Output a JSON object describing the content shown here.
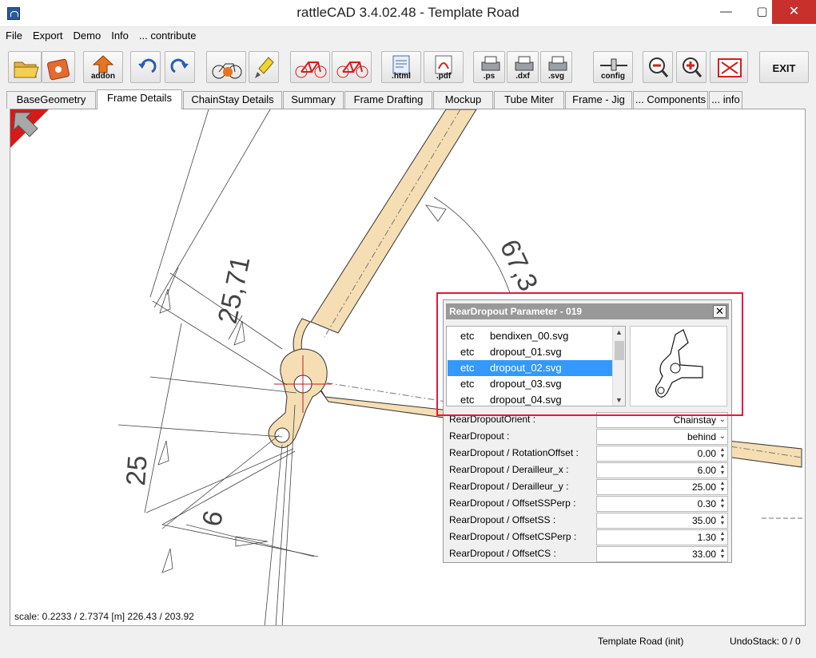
{
  "window": {
    "title": "rattleCAD  3.4.02.48 - Template Road",
    "minimize": "—",
    "maximize": "▢",
    "close": "✕"
  },
  "menu": [
    "File",
    "Export",
    "Demo",
    "Info",
    "... contribute"
  ],
  "toolbar": {
    "addon_label": "addon",
    "html_label": ".html",
    "pdf_label": ".pdf",
    "ps_label": ".ps",
    "dxf_label": ".dxf",
    "svg_label": ".svg",
    "config_label": "config",
    "exit_label": "EXIT"
  },
  "tabs": [
    "BaseGeometry",
    "Frame Details",
    "ChainStay Details",
    "Summary",
    "Frame Drafting",
    "Mockup",
    "Tube Miter",
    "Frame - Jig",
    "... Components",
    "... info"
  ],
  "active_tab": "Frame Details",
  "canvas": {
    "scale_text": "scale: 0.2233 / 2.7374  [m]  226.43 / 203.92",
    "dimensions": [
      "25,71",
      "25",
      "6",
      "67,3"
    ]
  },
  "panel": {
    "title": "RearDropout Parameter - 019",
    "close_icon": "✕",
    "files": [
      {
        "group": "etc",
        "name": "bendixen_00.svg"
      },
      {
        "group": "etc",
        "name": "dropout_01.svg"
      },
      {
        "group": "etc",
        "name": "dropout_02.svg"
      },
      {
        "group": "etc",
        "name": "dropout_03.svg"
      },
      {
        "group": "etc",
        "name": "dropout_04.svg"
      }
    ],
    "selected_file": "dropout_02.svg",
    "params": [
      {
        "label": "RearDropoutOrient  :",
        "value": "Chainstay",
        "kind": "select"
      },
      {
        "label": "RearDropout  :",
        "value": "behind",
        "kind": "select"
      },
      {
        "label": "RearDropout / RotationOffset  :",
        "value": "0.00",
        "kind": "spin"
      },
      {
        "label": "RearDropout / Derailleur_x  :",
        "value": "6.00",
        "kind": "spin"
      },
      {
        "label": "RearDropout / Derailleur_y  :",
        "value": "25.00",
        "kind": "spin"
      },
      {
        "label": "RearDropout / OffsetSSPerp  :",
        "value": "0.30",
        "kind": "spin"
      },
      {
        "label": "RearDropout / OffsetSS  :",
        "value": "35.00",
        "kind": "spin"
      },
      {
        "label": "RearDropout / OffsetCSPerp  :",
        "value": "1.30",
        "kind": "spin"
      },
      {
        "label": "RearDropout / OffsetCS  :",
        "value": "33.00",
        "kind": "spin"
      }
    ]
  },
  "status": {
    "template": "Template Road (init)",
    "undo": "UndoStack:  0 / 0"
  },
  "colors": {
    "tube_fill": "#f5deb3",
    "selection": "#3399ff",
    "highlight": "#e8173f",
    "panel_header": "#999999"
  }
}
